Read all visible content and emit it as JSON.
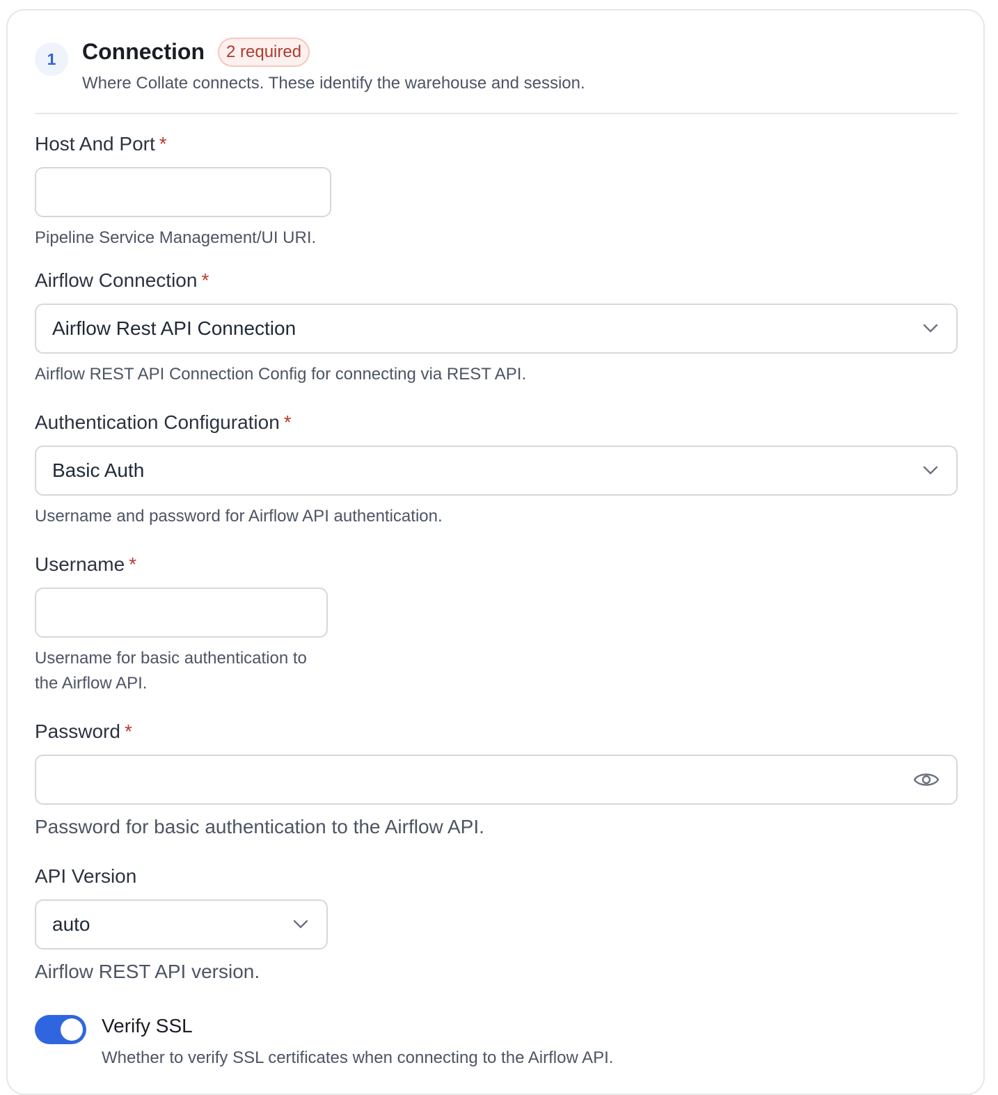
{
  "section": {
    "step": "1",
    "title": "Connection",
    "required_badge": "2 required",
    "description": "Where Collate connects. These identify the warehouse and session."
  },
  "fields": {
    "host_and_port": {
      "label": "Host And Port",
      "required": "*",
      "value": "",
      "help": "Pipeline Service Management/UI URI."
    },
    "airflow_connection": {
      "label": "Airflow Connection",
      "required": "*",
      "value": "Airflow Rest API Connection",
      "help": "Airflow REST API Connection Config for connecting via REST API."
    },
    "auth_config": {
      "label": "Authentication Configuration",
      "required": "*",
      "value": "Basic Auth",
      "help": "Username and password for Airflow API authentication."
    },
    "username": {
      "label": "Username",
      "required": "*",
      "value": "",
      "help_line1": "Username for basic authentication to",
      "help_line2": "the Airflow API."
    },
    "password": {
      "label": "Password",
      "required": "*",
      "value": "",
      "help": "Password for basic authentication to the Airflow API."
    },
    "api_version": {
      "label": "API Version",
      "value": "auto",
      "help": "Airflow REST API version."
    },
    "verify_ssl": {
      "label": "Verify SSL",
      "enabled": true,
      "help": "Whether to verify SSL certificates when connecting to the Airflow API."
    }
  },
  "icons": {
    "select": "chevron-down-icon",
    "password_toggle": "eye-icon"
  },
  "colors": {
    "accent": "#2f66e0",
    "required": "#c0392b",
    "badge_bg": "#fdf1ef",
    "badge_border": "#f6c6c0"
  }
}
